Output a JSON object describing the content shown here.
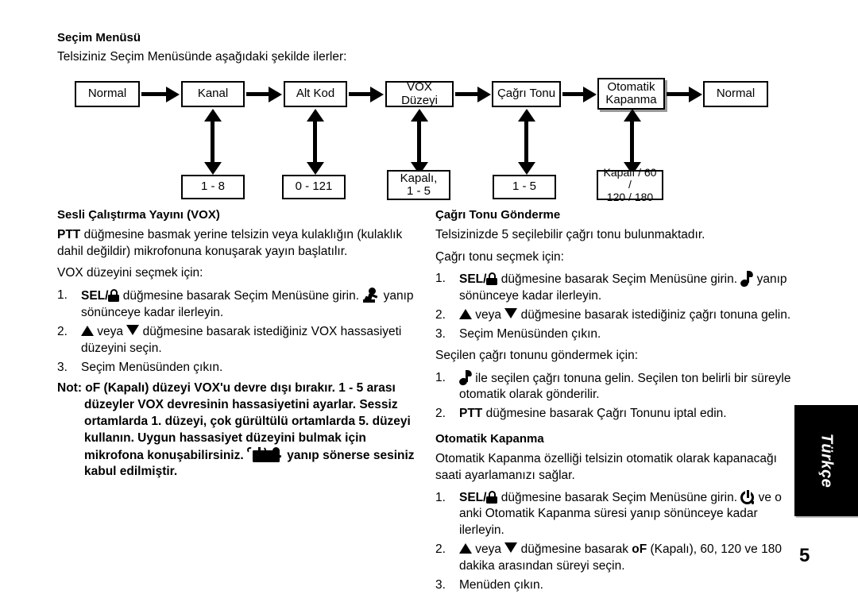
{
  "section": {
    "heading": "Seçim Menüsü",
    "intro": "Telsiziniz Seçim Menüsünde aşağıdaki şekilde ilerler:"
  },
  "flow": {
    "main_boxes": [
      {
        "label": "Normal"
      },
      {
        "label": "Kanal"
      },
      {
        "label": "Alt Kod"
      },
      {
        "label": "VOX Düzeyi"
      },
      {
        "label": "Çağrı Tonu"
      },
      {
        "label": "Otomatik\nKapanma"
      },
      {
        "label": "Normal"
      }
    ],
    "value_boxes": [
      {
        "label": "1 - 8"
      },
      {
        "label": "0 - 121"
      },
      {
        "label": "Kapalı,\n1 - 5"
      },
      {
        "label": "1 - 5"
      },
      {
        "label": "Kapalı / 60 /\n120 / 180"
      }
    ]
  },
  "vox": {
    "title": "Sesli Çalıştırma Yayını (VOX)",
    "p1_bold": "PTT",
    "p1_rest": " düğmesine basmak yerine telsizin veya kulaklığın (kulaklık dahil değildir) mikrofonuna konuşarak yayın başlatılır.",
    "p2": "VOX düzeyini seçmek için:",
    "step1_num": "1.",
    "step1_sel": "SEL/",
    "step1_mid": " düğmesine basarak Seçim Menüsüne girin. ",
    "step1_end": " yanıp sönünceye kadar ilerleyin.",
    "step2_num": "2.",
    "step2_a": " veya ",
    "step2_b": " düğmesine basarak istediğiniz VOX hassasiyeti düzeyini seçin.",
    "step3_num": "3.",
    "step3": "Seçim Menüsünden çıkın.",
    "note_label": "Not:",
    "note_line1": " oF (Kapalı) düzeyi VOX'u devre dışı bırakır. 1 - 5 arası",
    "note_body1": "düzeyler VOX devresinin hassasiyetini ayarlar. Sessiz ortamlarda 1. düzeyi, çok gürültülü ortamlarda 5. düzeyi kullanın. Uygun hassasiyet düzeyini bulmak için mikrofona konuşabilirsiniz. ",
    "note_body2": " yanıp sönerse sesiniz kabul edilmiştir."
  },
  "calltone": {
    "title": "Çağrı Tonu Gönderme",
    "p1": "Telsizinizde 5 seçilebilir çağrı tonu bulunmaktadır.",
    "p2": "Çağrı tonu seçmek için:",
    "step1_num": "1.",
    "step1_sel": "SEL/",
    "step1_mid": " düğmesine basarak Seçim Menüsüne girin. ",
    "step1_end": " yanıp sönünceye kadar ilerleyin.",
    "step2_num": "2.",
    "step2_a": " veya ",
    "step2_b": " düğmesine basarak istediğiniz çağrı tonuna gelin.",
    "step3_num": "3.",
    "step3": "Seçim Menüsünden çıkın.",
    "p3": "Seçilen çağrı tonunu göndermek için:",
    "send1_num": "1.",
    "send1_text": " ile seçilen çağrı tonuna gelin. Seçilen ton belirli bir süreyle otomatik olarak gönderilir.",
    "send2_num": "2.",
    "send2_bold": "PTT",
    "send2_rest": " düğmesine basarak Çağrı Tonunu iptal edin."
  },
  "autopower": {
    "title": "Otomatik Kapanma",
    "p1": "Otomatik Kapanma özelliği telsizin otomatik olarak kapanacağı saati ayarlamanızı sağlar.",
    "step1_num": "1.",
    "step1_sel": "SEL/",
    "step1_mid": " düğmesine basarak Seçim Menüsüne girin. ",
    "step1_end": " ve o anki Otomatik Kapanma süresi yanıp sönünceye kadar ilerleyin.",
    "step2_num": "2.",
    "step2_a": " veya ",
    "step2_b": " düğmesine basarak ",
    "step2_bold": "oF",
    "step2_c": " (Kapalı), 60, 120 ve 180 dakika arasından süreyi seçin.",
    "step3_num": "3.",
    "step3": "Menüden çıkın."
  },
  "sidebar": {
    "language": "Türkçe"
  },
  "page_number": "5",
  "colors": {
    "ink": "#000000",
    "paper": "#ffffff",
    "tab_bg": "#000000",
    "tab_text": "#ffffff",
    "shadow": "#9a9a9a"
  }
}
